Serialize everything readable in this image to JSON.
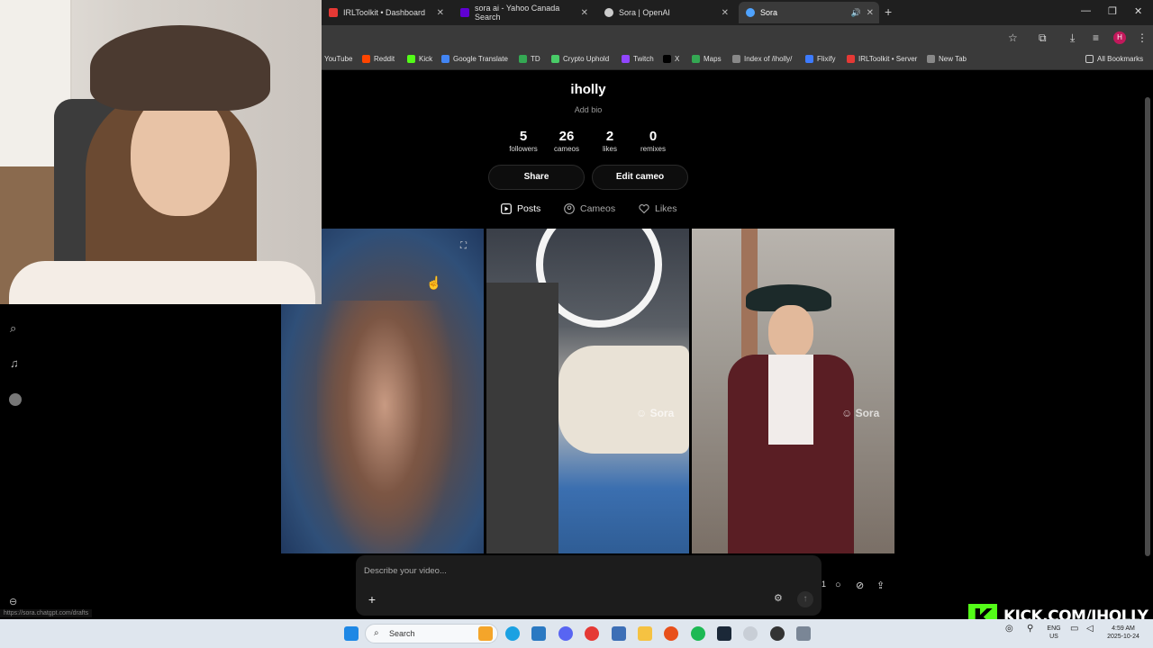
{
  "tabs": [
    {
      "label": "IRLToolkit • Dashboard",
      "color": "#e53935"
    },
    {
      "label": "sora ai - Yahoo Canada Search",
      "color": "#6001d2"
    },
    {
      "label": "Sora | OpenAI",
      "color": "#cccccc"
    },
    {
      "label": "Sora",
      "color": "#4fa3ff"
    }
  ],
  "bookmarks": [
    {
      "label": "YouTube",
      "color": "#ff0000"
    },
    {
      "label": "Reddit",
      "color": "#ff4500"
    },
    {
      "label": "Kick",
      "color": "#53fc18"
    },
    {
      "label": "Google Translate",
      "color": "#4285f4"
    },
    {
      "label": "TD",
      "color": "#34a853"
    },
    {
      "label": "Crypto Uphold",
      "color": "#49cc68"
    },
    {
      "label": "Twitch",
      "color": "#9146ff"
    },
    {
      "label": "X",
      "color": "#000000"
    },
    {
      "label": "Maps",
      "color": "#34a853"
    },
    {
      "label": "Index of /iholly/",
      "color": "#888888"
    },
    {
      "label": "Flixify",
      "color": "#3d7bff"
    },
    {
      "label": "IRLToolkit • Server",
      "color": "#e53935"
    },
    {
      "label": "New Tab",
      "color": "#888888"
    }
  ],
  "all_bookmarks": "All Bookmarks",
  "avatar_letter": "H",
  "profile": {
    "name": "iholly",
    "bio_placeholder": "Add bio",
    "stats": [
      {
        "value": "5",
        "label": "followers"
      },
      {
        "value": "26",
        "label": "cameos"
      },
      {
        "value": "2",
        "label": "likes"
      },
      {
        "value": "0",
        "label": "remixes"
      }
    ],
    "share_label": "Share",
    "edit_label": "Edit cameo",
    "tabs": [
      "Posts",
      "Cameos",
      "Likes"
    ]
  },
  "watermark": "Sora",
  "composer": {
    "placeholder": "Describe your video...",
    "count": "1"
  },
  "status_url": "https://sora.chatgpt.com/drafts",
  "kick_overlay": {
    "logo": "K",
    "text": "KICK.COM/IHOLLY"
  },
  "taskbar": {
    "search": "Search",
    "lang_line1": "ENG",
    "lang_line2": "US",
    "time": "4:59 AM",
    "date": "2025-10-24"
  }
}
